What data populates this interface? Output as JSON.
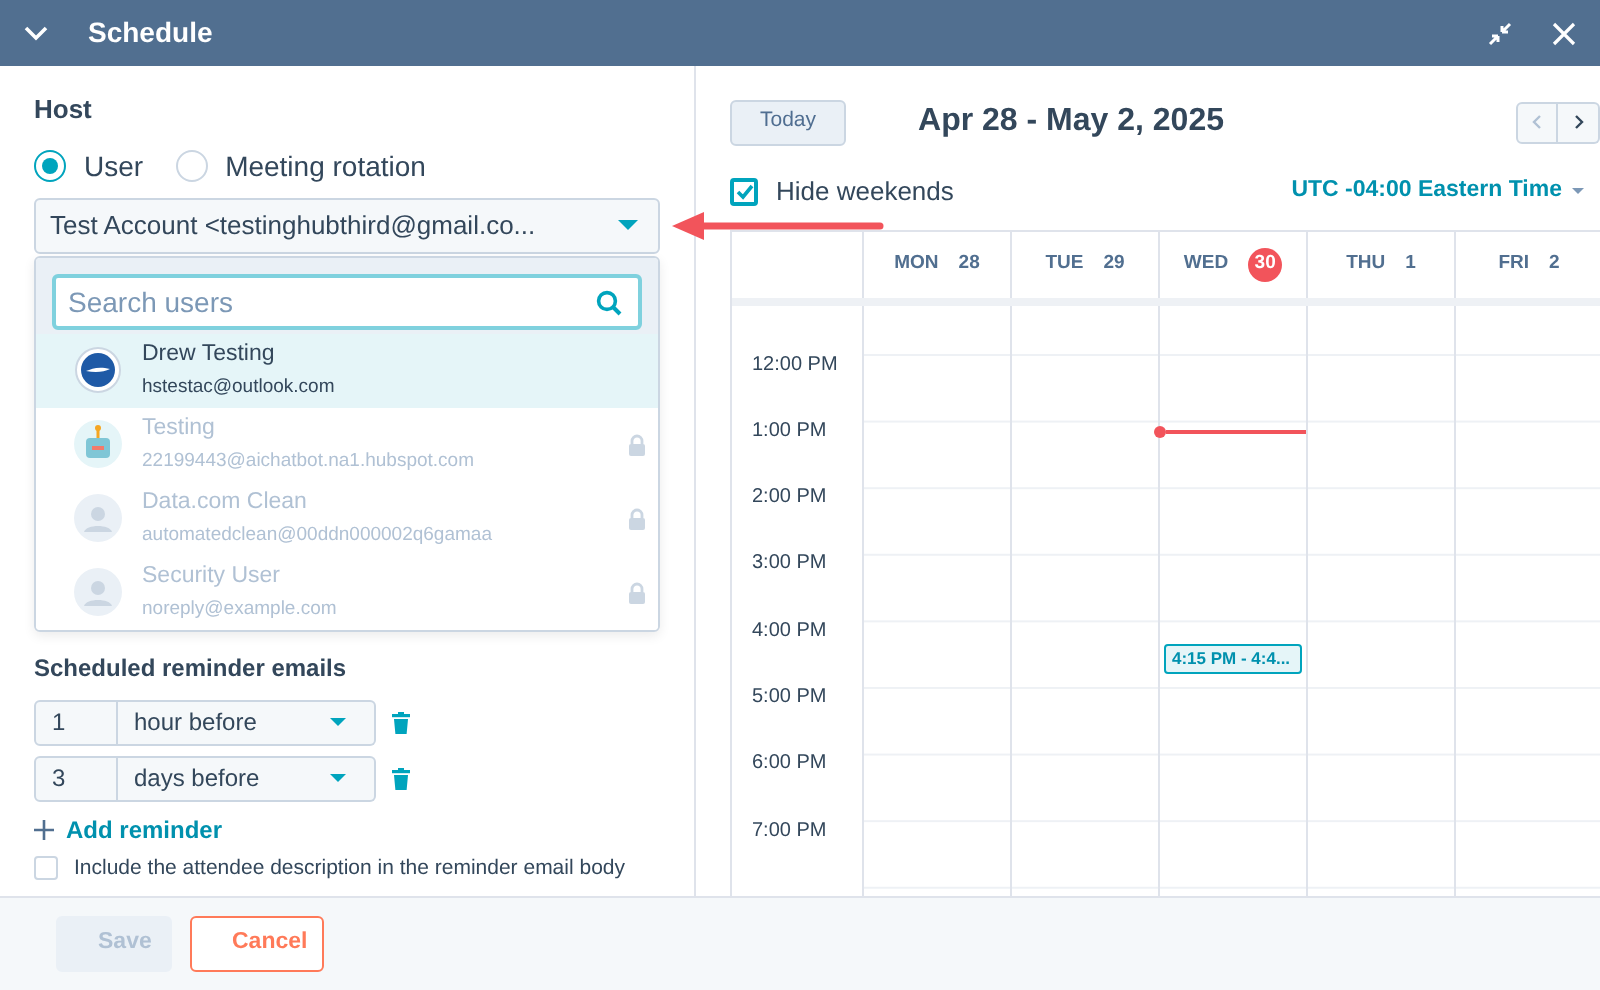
{
  "window": {
    "title": "Schedule"
  },
  "host": {
    "label": "Host",
    "options": [
      {
        "label": "User",
        "selected": true
      },
      {
        "label": "Meeting rotation",
        "selected": false
      }
    ],
    "value": "Test Account <testinghubthird@gmail.co...",
    "search": {
      "placeholder": "Search users"
    },
    "users": [
      {
        "name": "Drew Testing",
        "email": "hstestac@outlook.com",
        "selected": true,
        "disabled": false,
        "kind": "logo"
      },
      {
        "name": "Testing",
        "email": "22199443@aichatbot.na1.hubspot.com",
        "selected": false,
        "disabled": true,
        "kind": "bot"
      },
      {
        "name": "Data.com Clean",
        "email": "automatedclean@00ddn000002q6gamaa",
        "selected": false,
        "disabled": true,
        "kind": "person"
      },
      {
        "name": "Security User",
        "email": "noreply@example.com",
        "selected": false,
        "disabled": true,
        "kind": "person"
      }
    ]
  },
  "reminders": {
    "label": "Scheduled reminder emails",
    "items": [
      {
        "amount": "1",
        "unit": "hour before"
      },
      {
        "amount": "3",
        "unit": "days before"
      }
    ],
    "add_label": "Add reminder",
    "include": {
      "label": "Include the attendee description in the reminder email body",
      "checked": false
    }
  },
  "calendar": {
    "today_button": "Today",
    "range": "Apr 28 - May 2, 2025",
    "hide_weekends": {
      "label": "Hide weekends",
      "checked": true
    },
    "timezone": "UTC -04:00 Eastern Time",
    "days": [
      {
        "weekday": "MON",
        "date": "28",
        "today": false
      },
      {
        "weekday": "TUE",
        "date": "29",
        "today": false
      },
      {
        "weekday": "WED",
        "date": "30",
        "today": true,
        "events": [
          {
            "label": "4:15 PM - 4:4..."
          }
        ]
      },
      {
        "weekday": "THU",
        "date": "1",
        "today": false
      },
      {
        "weekday": "FRI",
        "date": "2",
        "today": false
      }
    ],
    "times": [
      "12:00 PM",
      "1:00 PM",
      "2:00 PM",
      "3:00 PM",
      "4:00 PM",
      "5:00 PM",
      "6:00 PM",
      "7:00 PM"
    ]
  },
  "buttons": [
    {
      "label": "Save",
      "kind": "primary",
      "disabled": true
    },
    {
      "label": "Cancel",
      "kind": "secondary",
      "disabled": false
    }
  ]
}
